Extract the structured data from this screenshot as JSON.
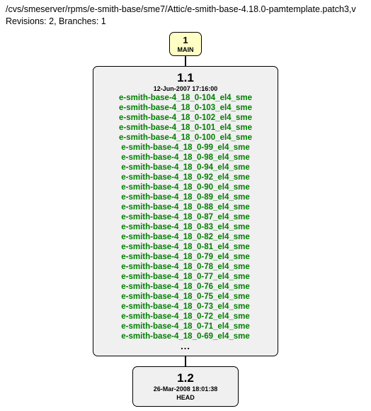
{
  "header": {
    "path": "/cvs/smeserver/rpms/e-smith-base/sme7/Attic/e-smith-base-4.18.0-pamtemplate.patch3,v",
    "meta": "Revisions: 2, Branches: 1"
  },
  "mainNode": {
    "number": "1",
    "label": "MAIN"
  },
  "rev1": {
    "version": "1.1",
    "date": "12-Jun-2007 17:16:00",
    "tags": [
      "e-smith-base-4_18_0-104_el4_sme",
      "e-smith-base-4_18_0-103_el4_sme",
      "e-smith-base-4_18_0-102_el4_sme",
      "e-smith-base-4_18_0-101_el4_sme",
      "e-smith-base-4_18_0-100_el4_sme",
      "e-smith-base-4_18_0-99_el4_sme",
      "e-smith-base-4_18_0-98_el4_sme",
      "e-smith-base-4_18_0-94_el4_sme",
      "e-smith-base-4_18_0-92_el4_sme",
      "e-smith-base-4_18_0-90_el4_sme",
      "e-smith-base-4_18_0-89_el4_sme",
      "e-smith-base-4_18_0-88_el4_sme",
      "e-smith-base-4_18_0-87_el4_sme",
      "e-smith-base-4_18_0-83_el4_sme",
      "e-smith-base-4_18_0-82_el4_sme",
      "e-smith-base-4_18_0-81_el4_sme",
      "e-smith-base-4_18_0-79_el4_sme",
      "e-smith-base-4_18_0-78_el4_sme",
      "e-smith-base-4_18_0-77_el4_sme",
      "e-smith-base-4_18_0-76_el4_sme",
      "e-smith-base-4_18_0-75_el4_sme",
      "e-smith-base-4_18_0-73_el4_sme",
      "e-smith-base-4_18_0-72_el4_sme",
      "e-smith-base-4_18_0-71_el4_sme",
      "e-smith-base-4_18_0-69_el4_sme"
    ],
    "ellipsis": "..."
  },
  "rev2": {
    "version": "1.2",
    "date": "26-Mar-2008 18:01:38",
    "head": "HEAD"
  }
}
